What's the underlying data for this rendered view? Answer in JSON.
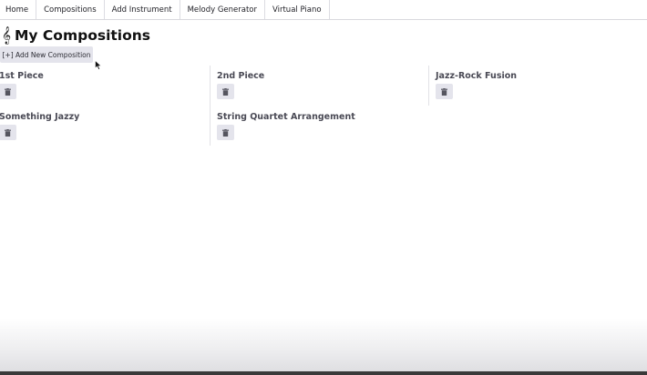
{
  "nav": {
    "items": [
      {
        "label": "Home"
      },
      {
        "label": "Compositions"
      },
      {
        "label": "Add Instrument"
      },
      {
        "label": "Melody Generator"
      },
      {
        "label": "Virtual Piano"
      }
    ]
  },
  "header": {
    "icon": "treble-clef-icon",
    "title": "My Compositions"
  },
  "actions": {
    "add_label": "[+] Add New Composition"
  },
  "compositions": [
    {
      "title": "1st Piece"
    },
    {
      "title": "2nd Piece"
    },
    {
      "title": "Jazz-Rock Fusion"
    },
    {
      "title": "Something Jazzy"
    },
    {
      "title": "String Quartet Arrangement"
    }
  ],
  "icons": {
    "delete": "trash-icon"
  },
  "colors": {
    "button_bg": "#e4e4ec",
    "title_text": "#111111",
    "card_title": "#4a4a55"
  }
}
